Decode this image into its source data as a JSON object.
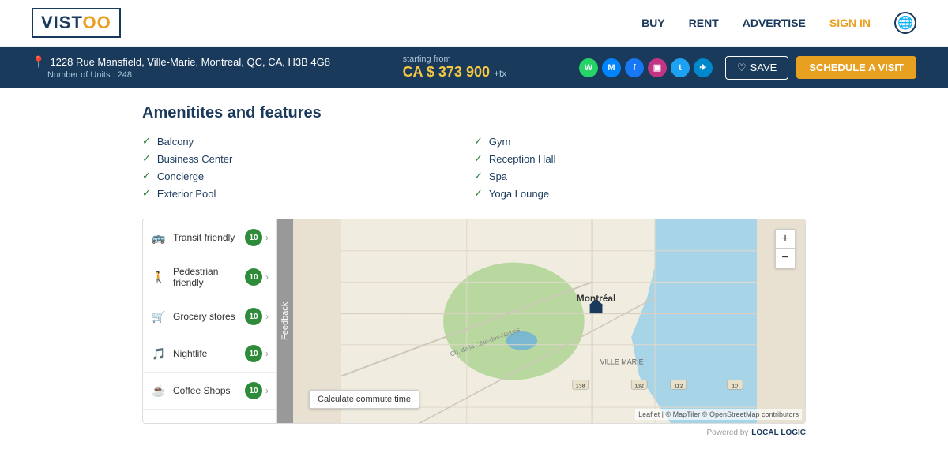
{
  "navbar": {
    "logo_text": "VIST",
    "logo_oo": "OO",
    "links": [
      {
        "id": "buy",
        "label": "BUY"
      },
      {
        "id": "rent",
        "label": "RENT"
      },
      {
        "id": "advertise",
        "label": "ADVERTISE"
      },
      {
        "id": "signin",
        "label": "SIGN IN"
      }
    ]
  },
  "header": {
    "address": "1228 Rue Mansfield, Ville-Marie, Montreal, QC, CA, H3B 4G8",
    "units_text": "Number of Units : 248",
    "starting_from_label": "starting from",
    "price": "CA $ 373 900",
    "tax_label": "+tx",
    "save_label": "SAVE",
    "schedule_label": "SCHEDULE A VISIT"
  },
  "amenities": {
    "title": "Amenitites and features",
    "left_items": [
      "Balcony",
      "Business Center",
      "Concierge",
      "Exterior Pool"
    ],
    "right_items": [
      "Gym",
      "Reception Hall",
      "Spa",
      "Yoga Lounge"
    ]
  },
  "map_sidebar": {
    "items": [
      {
        "icon": "🚌",
        "label": "Transit friendly",
        "score": "10"
      },
      {
        "icon": "🚶",
        "label": "Pedestrian friendly",
        "score": "10"
      },
      {
        "icon": "🛒",
        "label": "Grocery stores",
        "score": "10"
      },
      {
        "icon": "🎵",
        "label": "Nightlife",
        "score": "10"
      },
      {
        "icon": "☕",
        "label": "Coffee Shops",
        "score": "10"
      }
    ],
    "feedback_label": "Feedback"
  },
  "map": {
    "calculate_commute_label": "Calculate commute time",
    "attribution": "Leaflet | © MapTiler © OpenStreetMap contributors",
    "montreal_label": "Montréal",
    "zoom_in": "+",
    "zoom_out": "−"
  },
  "powered_by": {
    "text": "Powered by",
    "brand": "LOCAL LOGIC"
  }
}
